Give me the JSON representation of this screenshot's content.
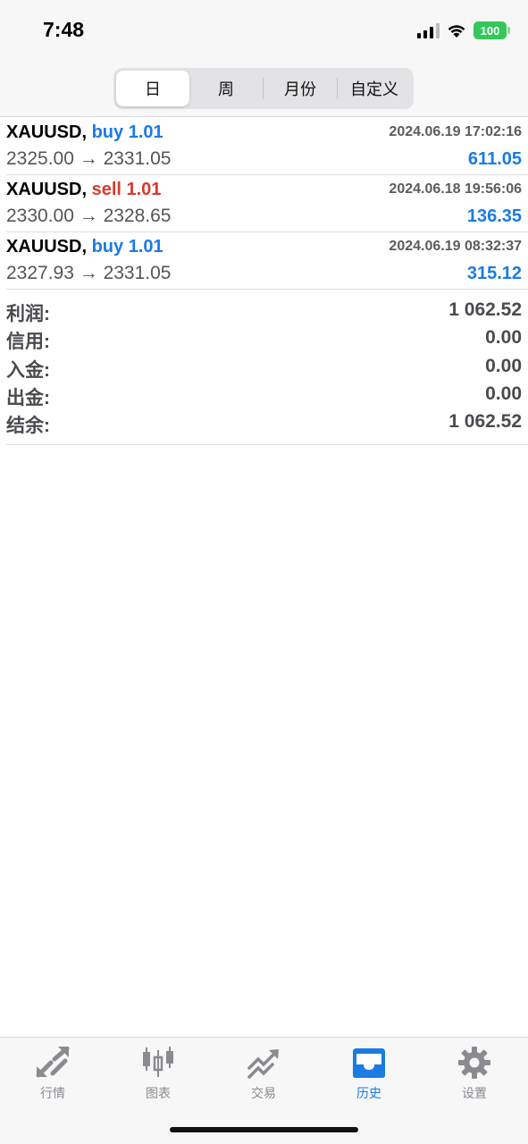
{
  "status_bar": {
    "time": "7:48",
    "battery": "100"
  },
  "period_tabs": [
    {
      "label": "日",
      "active": true
    },
    {
      "label": "周",
      "active": false
    },
    {
      "label": "月份",
      "active": false
    },
    {
      "label": "自定义",
      "active": false
    }
  ],
  "trades": [
    {
      "symbol": "XAUUSD,",
      "type": "buy 1.01",
      "side": "buy",
      "datetime": "2024.06.19 17:02:16",
      "prices": "2325.00 → 2331.05",
      "profit": "611.05"
    },
    {
      "symbol": "XAUUSD,",
      "type": "sell 1.01",
      "side": "sell",
      "datetime": "2024.06.18 19:56:06",
      "prices": "2330.00 → 2328.65",
      "profit": "136.35"
    },
    {
      "symbol": "XAUUSD,",
      "type": "buy 1.01",
      "side": "buy",
      "datetime": "2024.06.19 08:32:37",
      "prices": "2327.93 → 2331.05",
      "profit": "315.12"
    }
  ],
  "summary": [
    {
      "label": "利润:",
      "value": "1 062.52"
    },
    {
      "label": "信用:",
      "value": "0.00"
    },
    {
      "label": "入金:",
      "value": "0.00"
    },
    {
      "label": "出金:",
      "value": "0.00"
    },
    {
      "label": "结余:",
      "value": "1 062.52"
    }
  ],
  "tabbar": [
    {
      "label": "行情",
      "icon": "quotes-arrows-icon",
      "active": false
    },
    {
      "label": "图表",
      "icon": "candlestick-chart-icon",
      "active": false
    },
    {
      "label": "交易",
      "icon": "trade-trend-icon",
      "active": false
    },
    {
      "label": "历史",
      "icon": "history-inbox-icon",
      "active": true
    },
    {
      "label": "设置",
      "icon": "gear-icon",
      "active": false
    }
  ],
  "colors": {
    "accent": "#1a7be3",
    "sell": "#d83a2e",
    "battery": "#34c759"
  }
}
